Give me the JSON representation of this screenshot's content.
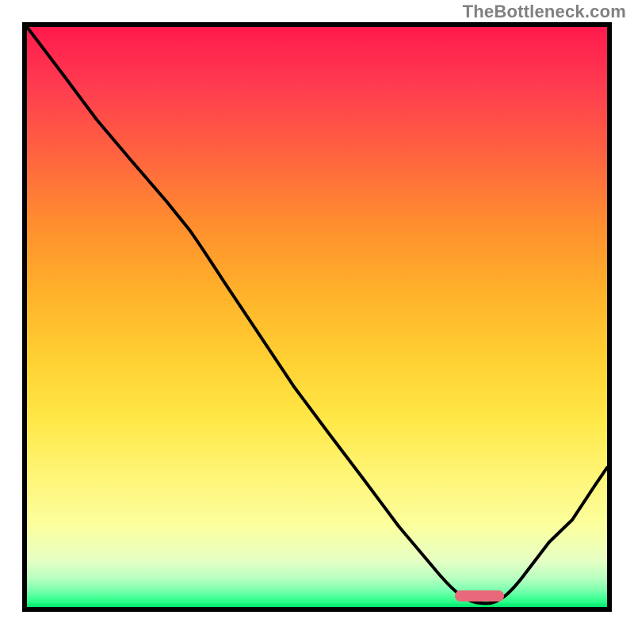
{
  "watermark": "TheBottleneck.com",
  "colors": {
    "border": "#000000",
    "curve": "#000000",
    "marker": "#e8697a",
    "gradient_top": "#ff1a4d",
    "gradient_bottom": "#00e56d"
  },
  "chart_data": {
    "type": "line",
    "title": "",
    "xlabel": "",
    "ylabel": "",
    "xlim": [
      0,
      100
    ],
    "ylim": [
      0,
      100
    ],
    "grid": false,
    "legend": false,
    "background": "red-yellow-green vertical gradient",
    "note": "Axes are unlabeled; values below are read off pixel positions and normalized to 0-100 (x left→right, y bottom→top).",
    "series": [
      {
        "name": "bottleneck-curve",
        "x": [
          0,
          6,
          12,
          18,
          24,
          28,
          34,
          40,
          46,
          52,
          58,
          64,
          70,
          74,
          78,
          82,
          86,
          90,
          94,
          98,
          100
        ],
        "y": [
          100,
          92,
          84,
          77,
          70,
          65,
          56,
          47,
          38,
          30,
          22,
          14,
          7,
          3,
          1,
          1,
          4,
          9,
          15,
          21,
          24
        ]
      }
    ],
    "marker": {
      "shape": "rounded-bar",
      "x_center": 78,
      "y": 1.5,
      "width_x_units": 8
    }
  }
}
